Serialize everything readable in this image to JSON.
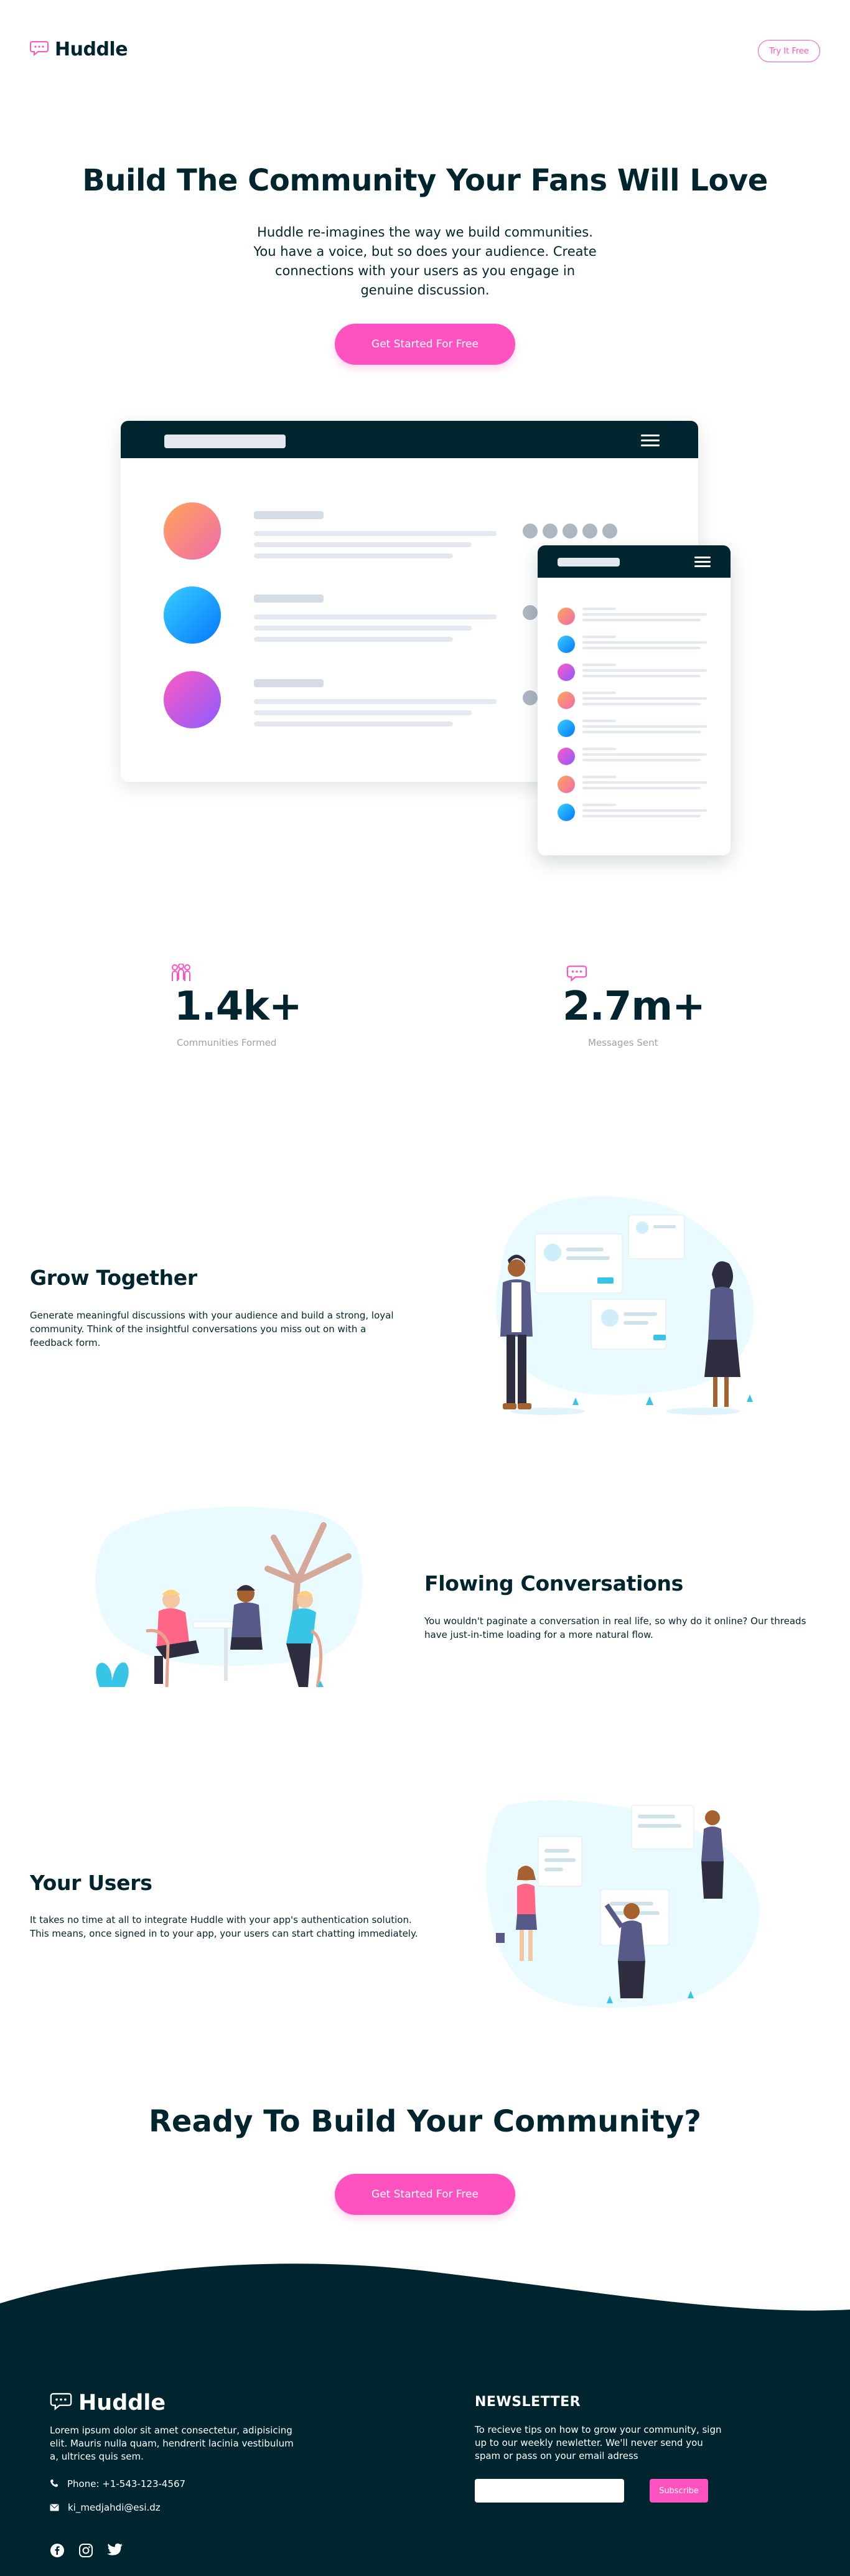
{
  "header": {
    "logo_text": "Huddle",
    "try_button": "Try It Free"
  },
  "hero": {
    "title": "Build The Community Your Fans Will Love",
    "subtitle": "Huddle re-imagines the way we build communities. You have a voice, but so does your audience. Create connections with your users as you engage in genuine discussion.",
    "cta": "Get Started For Free"
  },
  "stats": [
    {
      "icon": "communities-icon",
      "value": "1.4k+",
      "label": "Communities Formed"
    },
    {
      "icon": "messages-icon",
      "value": "2.7m+",
      "label": "Messages Sent"
    }
  ],
  "features": [
    {
      "title": "Grow Together",
      "text": "Generate meaningful discussions with your audience and build a strong, loyal community. Think of the insightful conversations you miss out on with a feedback form."
    },
    {
      "title": "Flowing Conversations",
      "text": "You wouldn't paginate a conversation in real life, so why do it online? Our threads have just-in-time loading for a more natural flow."
    },
    {
      "title": "Your Users",
      "text": "It takes no time at all to integrate Huddle with your app's authentication solution. This means, once signed in to your app, your users can start chatting immediately."
    }
  ],
  "cta": {
    "title": "Ready To Build Your Community?",
    "button": "Get Started For Free"
  },
  "footer": {
    "logo_text": "Huddle",
    "about": "Lorem ipsum dolor sit amet consectetur, adipisicing elit. Mauris nulla quam, hendrerit lacinia vestibulum a, ultrices quis sem.",
    "phone": "Phone: +1-543-123-4567",
    "email": "ki_medjahdi@esi.dz",
    "newsletter_heading": "NEWSLETTER",
    "newsletter_text": "To recieve tips on how to grow your community, sign up to our weekly newletter. We'll never send you spam or pass on your email adress",
    "subscribe": "Subscribe",
    "email_value": ""
  },
  "colors": {
    "pink": "#ff52c1",
    "dark": "#00252e",
    "light_blue": "#eafbff"
  }
}
